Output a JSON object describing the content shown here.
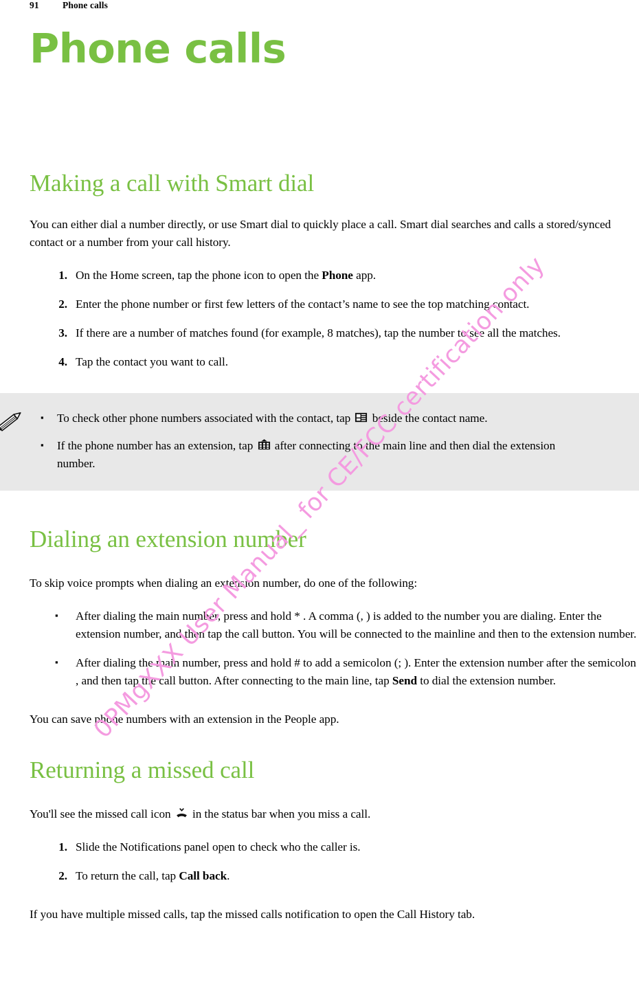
{
  "header": {
    "page_number": "91",
    "chapter": "Phone calls"
  },
  "title": "Phone calls",
  "watermark": "0PMgXXX User Manual_ for CE/FCC certification only",
  "colors": {
    "heading_green": "#79c043",
    "note_background": "#e8e8e8",
    "watermark_pink": "#f49be0"
  },
  "sections": {
    "smart_dial": {
      "heading": "Making a call with Smart dial",
      "intro": "You can either dial a number directly, or use Smart dial to quickly place a call. Smart dial searches and calls a stored/synced contact or a number from your call history.",
      "steps": [
        {
          "marker": "1.",
          "text_before": "On the Home screen, tap the phone icon to open the ",
          "bold": "Phone",
          "text_after": " app."
        },
        {
          "marker": "2.",
          "text_before": "Enter the phone number or first few letters of the contact’s name to see the top matching contact.",
          "bold": "",
          "text_after": ""
        },
        {
          "marker": "3.",
          "text_before": "If there are a number of matches found (for example, 8 matches), tap the number to see all the matches.",
          "bold": "",
          "text_after": ""
        },
        {
          "marker": "4.",
          "text_before": "Tap the contact you want to call.",
          "bold": "",
          "text_after": ""
        }
      ]
    },
    "note": {
      "icon": "pencil-icon",
      "items": [
        {
          "marker": "▪",
          "text_before": "To check other phone numbers associated with the contact, tap ",
          "icon": "contact-card-icon",
          "text_after": " beside the contact name."
        },
        {
          "marker": "▪",
          "text_before": "If the phone number has an extension, tap ",
          "icon": "dialpad-icon",
          "text_after": " after connecting to the main line and then dial the extension number."
        }
      ]
    },
    "extension": {
      "heading": "Dialing an extension number",
      "intro": "To skip voice prompts when dialing an extension number, do one of the following:",
      "bullets": [
        {
          "marker": "▪",
          "text": "After dialing the main number, press and hold * . A comma (, ) is added to the number you are dialing. Enter the extension number, and then tap the call button. You will be connected to the mainline and then to the extension number."
        },
        {
          "marker": "▪",
          "text_before": "After dialing the main number, press and hold # to add a semicolon (; ). Enter the extension number after the semicolon , and then tap the call button. After connecting to the main line, tap ",
          "bold": "Send",
          "text_after": " to dial the extension number."
        }
      ],
      "closing": "You can save phone numbers with an extension in the People app."
    },
    "missed_call": {
      "heading": "Returning a missed call",
      "intro_before": "You'll see the missed call icon ",
      "intro_icon": "missed-call-icon",
      "intro_after": " in the status bar when you miss a call.",
      "steps": [
        {
          "marker": "1.",
          "text_before": "Slide the Notifications panel open to check who the caller is.",
          "bold": "",
          "text_after": ""
        },
        {
          "marker": "2.",
          "text_before": "To return the call, tap ",
          "bold": "Call back",
          "text_after": "."
        }
      ],
      "closing": "If you have multiple missed calls, tap the missed calls notification to open the Call History tab."
    }
  }
}
